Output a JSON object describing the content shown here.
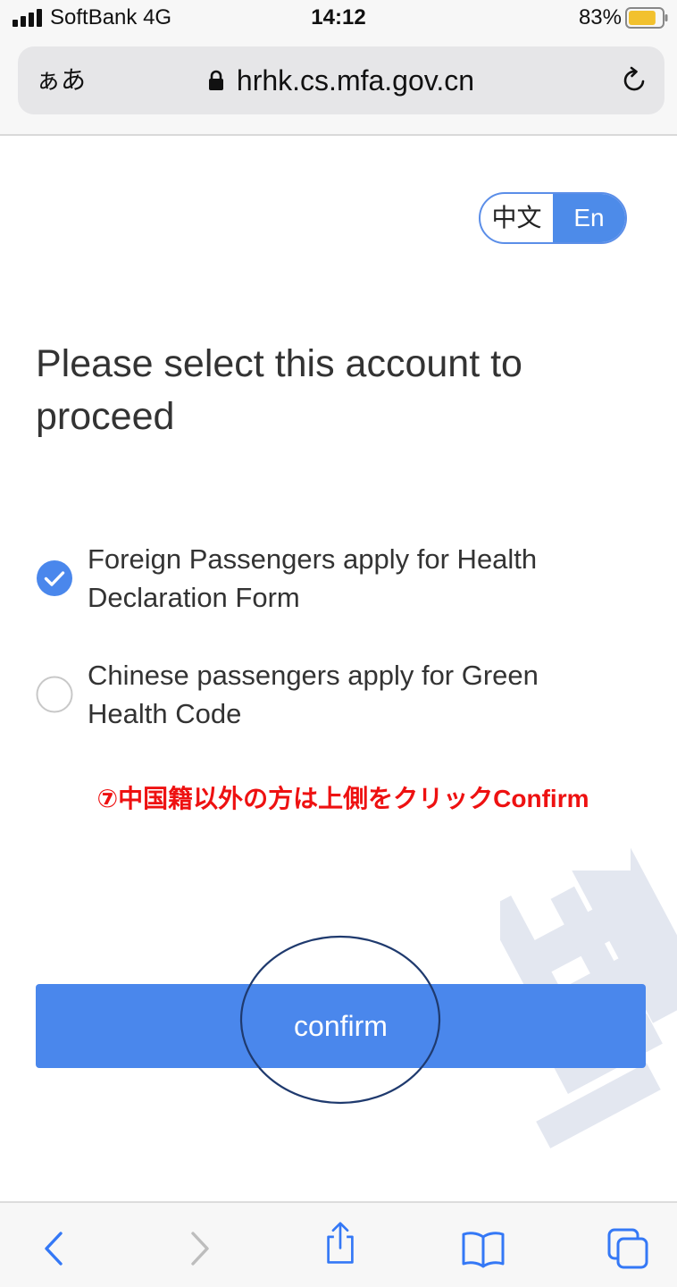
{
  "status_bar": {
    "carrier": "SoftBank  4G",
    "time": "14:12",
    "battery": "83%",
    "battery_level": 0.83,
    "signal_icon": "cellular-signal-icon",
    "battery_icon": "battery-icon"
  },
  "browser": {
    "text_size_label": "ぁあ",
    "url": "hrhk.cs.mfa.gov.cn",
    "lock_icon": "lock-icon",
    "reload_icon": "reload-icon"
  },
  "language_toggle": {
    "chinese_label": "中文",
    "english_label": "En",
    "selected": "En"
  },
  "page": {
    "title": "Please select this account to proceed"
  },
  "options": [
    {
      "label": "Foreign Passengers apply for Health Declaration Form",
      "checked": true
    },
    {
      "label": "Chinese passengers apply for Green Health Code",
      "checked": false
    }
  ],
  "annotation": {
    "text": "⑦中国籍以外の方は上側をクリックConfirm"
  },
  "confirm_button": {
    "label": "confirm"
  },
  "toolbar": {
    "back_icon": "chevron-left-icon",
    "forward_icon": "chevron-right-icon",
    "share_icon": "share-icon",
    "bookmarks_icon": "book-icon",
    "tabs_icon": "tabs-icon"
  },
  "colors": {
    "accent": "#4a87ec",
    "annotation_text": "#ee1111",
    "title_text": "#333333"
  }
}
